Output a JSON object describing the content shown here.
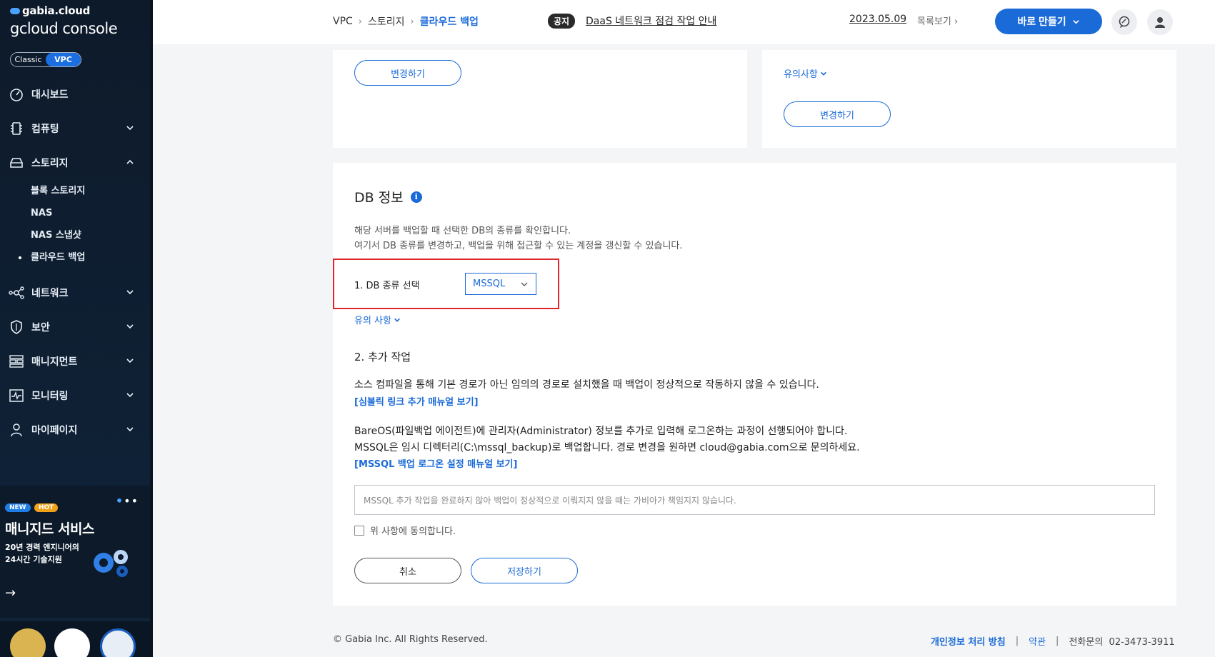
{
  "brand": {
    "top": "gabia.cloud",
    "main": "gcloud console"
  },
  "mode_toggle": {
    "classic": "Classic",
    "vpc": "VPC"
  },
  "sidebar": {
    "items": [
      {
        "label": "대시보드"
      },
      {
        "label": "컴퓨팅"
      },
      {
        "label": "스토리지"
      },
      {
        "label": "네트워크"
      },
      {
        "label": "보안"
      },
      {
        "label": "매니지먼트"
      },
      {
        "label": "모니터링"
      },
      {
        "label": "마이페이지"
      }
    ],
    "storage_sub": [
      {
        "label": "블록 스토리지"
      },
      {
        "label": "NAS"
      },
      {
        "label": "NAS 스냅샷"
      },
      {
        "label": "클라우드 백업"
      }
    ]
  },
  "promo": {
    "badge_new": "NEW",
    "badge_hot": "HOT",
    "title": "매니지드 서비스",
    "sub1": "20년 경력 엔지니어의",
    "sub2": "24시간 기술지원",
    "arrow": "→"
  },
  "header": {
    "breadcrumb": [
      "VPC",
      "스토리지",
      "클라우드 백업"
    ],
    "notice_tag": "공지",
    "notice_text": "DaaS 네트워크 점검 작업 안내",
    "notice_date": "2023.05.09",
    "notice_list": "목록보기",
    "make_button": "바로 만들기"
  },
  "top_cards": {
    "left_change_button": "변경하기",
    "right_notes_link": "유의사항",
    "right_change_button": "변경하기"
  },
  "db_info": {
    "title": "DB 정보",
    "desc1": "해당 서버를 백업할 때 선택한 DB의 종류를 확인합니다.",
    "desc2": "여기서 DB 종류를 변경하고, 백업을 위해 접근할 수 있는 계정을 갱신할 수 있습니다.",
    "step1_label": "1. DB 종류 선택",
    "db_type": "MSSQL",
    "notes_link": "유의 사항",
    "step2_title": "2. 추가 작업",
    "text1": "소스 컴파일을 통해 기본 경로가 아닌 임의의 경로로 설치했을 때 백업이 정상적으로 작동하지 않을 수 있습니다.",
    "link1": "[심볼릭 링크 추가 매뉴얼 보기]",
    "text2": "BareOS(파일백업 에이전트)에 관리자(Administrator) 정보를 추가로 입력해 로그온하는 과정이 선행되어야 합니다.",
    "text3": "MSSQL은 임시 디렉터리(C:\\mssql_backup)로 백업합니다. 경로 변경을 원하면 cloud@gabia.com으로 문의하세요.",
    "link2": "[MSSQL 백업 로그온 설정 매뉴얼 보기]",
    "disclaimer": "MSSQL 추가 작업을 완료하지 않아 백업이 정상적으로 이뤄지지 않을 때는 가비아가 책임지지 않습니다.",
    "agree": "위 사항에 동의합니다.",
    "cancel_button": "취소",
    "save_button": "저장하기"
  },
  "footer": {
    "copyright": "© Gabia Inc. All Rights Reserved.",
    "privacy": "개인정보 처리 방침",
    "terms": "약관",
    "phone_label": "전화문의",
    "phone": "02-3473-3911"
  },
  "colors": {
    "accent": "#1a6ad8",
    "sidebar_bg": "#0f2034",
    "highlight": "#e0262a"
  }
}
